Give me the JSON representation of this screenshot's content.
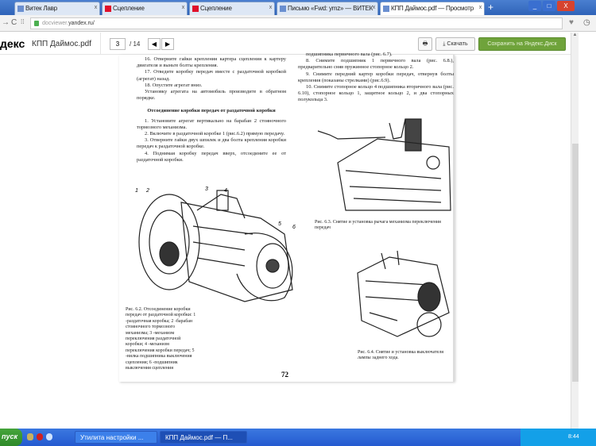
{
  "browser": {
    "tabs": [
      {
        "label": "Витек Лавр",
        "icon": "page-icon"
      },
      {
        "label": "Сцепление",
        "icon": "opera-icon"
      },
      {
        "label": "Сцепление",
        "icon": "opera-icon"
      },
      {
        "label": "Письмо «Fwd: ymz» — ВИТЕК",
        "icon": "mail-icon"
      },
      {
        "label": "КПП Даймос.pdf — Просмотр",
        "icon": "page-icon",
        "active": true
      }
    ],
    "url_prefix": "docviewer.",
    "url_domain": "yandex.ru/"
  },
  "viewer": {
    "logo": "декс",
    "filename": "КПП Даймос.pdf",
    "page": "3",
    "total": "/ 14",
    "print": "🖶",
    "download": "Скачать",
    "save": "Сохранить на Яндекс.Диск"
  },
  "doc": {
    "left": [
      "16. Отверните гайки крепления картера сцепления к картеру двигателя и выньте болты крепления.",
      "17. Отведите коробку передач вместе с раздаточной коробкой (агрегат) назад.",
      "18. Опустите агрегат вниз.",
      "Установку агрегата на автомобиль производите в обратном порядке."
    ],
    "heading": "Отсоединение коробки передач от раздаточной коробки",
    "left2": [
      "1. Установите агрегат вертикально на барабан 2 стояночного тормозного механизма.",
      "2. Включите в раздаточной коробке 1 (рис.6.2) прямую передачу.",
      "3. Отверните гайки двух шпилек и два болта крепления коробки передач к раздаточной коробке.",
      "4. Поднимая коробку передач вверх, отсоедините ее от раздаточной коробки."
    ],
    "right": [
      "подшипника первичного вала (рис. 6.7).",
      "8. Снимите подшипник 1 первичного вала (рис. 6.8.), предварительно сняв пружинное стопорное кольцо 2.",
      "9. Снимите передний картер коробки передач, отвернув болты крепления (показаны стрелками) (рис.6.9).",
      "10. Снимите стопорное кольцо 4 подшипника вторичного вала (рис. 6.10), стопорное кольцо 1, защитное кольцо 2, и два стопорных полукольца 3."
    ],
    "fig62": "Рис. 6.2. Отсоединение коробки передач от раздаточной коробки: 1 -раздаточная коробка; 2 -барабан стояночного тормозного механизма; 3 -механизм переключения раздаточной коробки; 4 -механизм переключения коробки передач; 5 -вилка подшипника выключения сцепления; 6 -подшипник выключения сцепления",
    "fig63": "Рис. 6.3. Снятие и установка рычага механизма переключения передач",
    "fig64": "Рис. 6.4. Снятие и установка выключателя лампы заднего хода.",
    "labels": [
      "1",
      "2",
      "3",
      "4",
      "5",
      "6"
    ],
    "page_number": "72"
  },
  "taskbar": {
    "start": "пуск",
    "items": [
      "Утилита настройки ...",
      "КПП Даймос.pdf — П..."
    ],
    "clock": "8:44"
  }
}
